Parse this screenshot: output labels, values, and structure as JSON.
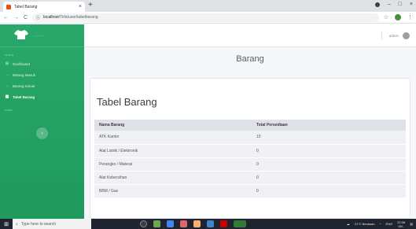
{
  "browser": {
    "tab_title": "Tabel Barang",
    "tab_close": "×",
    "new_tab": "+",
    "url_host": "localhost",
    "url_path": "/Tefa/user/tabelbarang",
    "back": "←",
    "forward": "→",
    "reload": "C",
    "info": "ⓘ",
    "star": "☆",
    "menu": "⋮",
    "minimize": "–",
    "maximize": "□",
    "close": "×"
  },
  "sidebar": {
    "brand_icon": "shirt-icon",
    "brand_name": "··········",
    "section1_label": "ADMIN",
    "section2_label": "USER",
    "items": [
      {
        "icon": "⊞",
        "label": "Dashboard",
        "active": false
      },
      {
        "icon": "→",
        "label": "Barang Masuk",
        "active": false
      },
      {
        "icon": "←",
        "label": "Barang Keluar",
        "active": false
      },
      {
        "icon": "▦",
        "label": "Tabel Barang",
        "active": true
      }
    ],
    "toggle": "‹"
  },
  "topnav": {
    "username": "admin"
  },
  "main": {
    "page_title": "Barang",
    "card_title": "Tabel Barang",
    "table": {
      "headers": [
        "Nama Barang",
        "Total Persediaan"
      ],
      "rows": [
        [
          "ATK Kantor",
          "10"
        ],
        [
          "Alat Listrik / Elektronik",
          "0"
        ],
        [
          "Perangko / Materai",
          "0"
        ],
        [
          "Alat Kebersihan",
          "0"
        ],
        [
          "BBM / Gas",
          "0"
        ]
      ]
    }
  },
  "taskbar": {
    "start": "⊞",
    "search_placeholder": "Type here to search",
    "weather": "21°C Berawan",
    "lang": "ENG",
    "time": "22:06",
    "date": "05/..",
    "colors": {
      "accent": "#28a86a"
    }
  }
}
